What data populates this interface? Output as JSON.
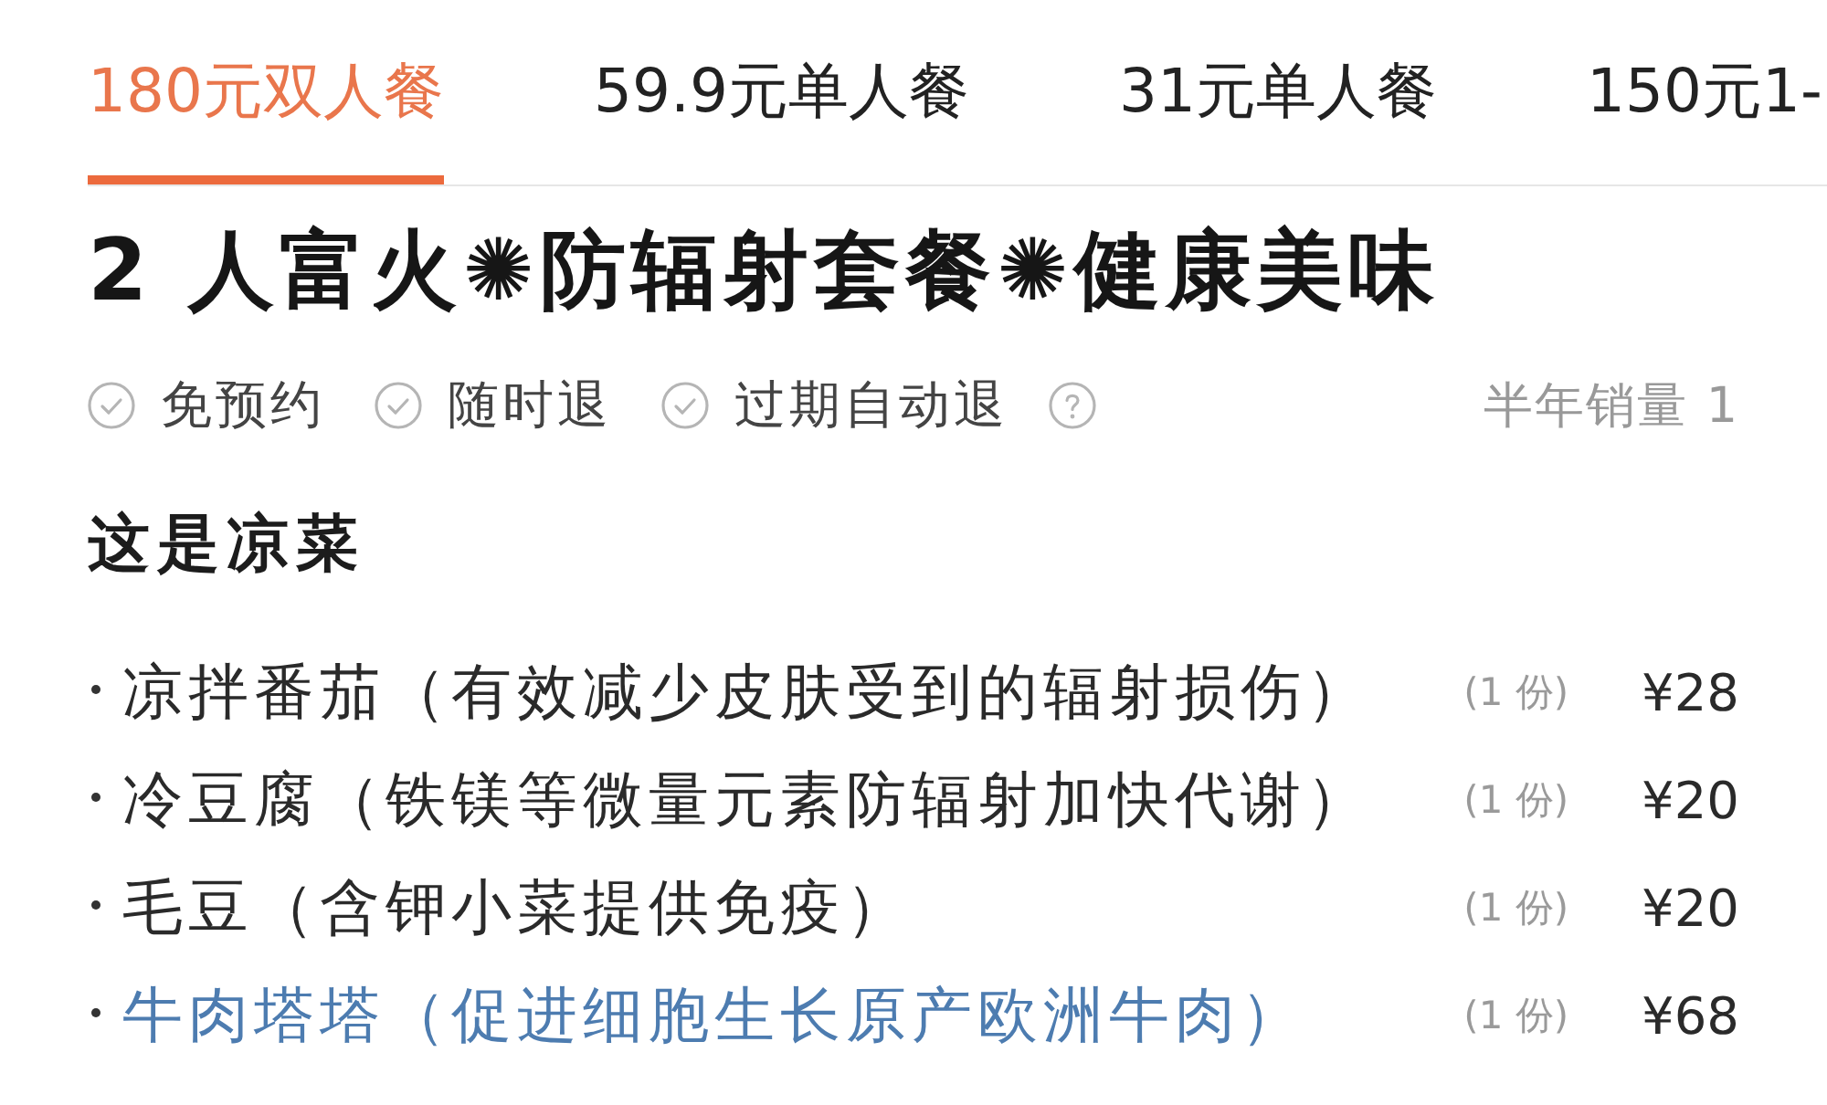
{
  "tabs": [
    {
      "label": "180元双人餐",
      "selected": true
    },
    {
      "label": "59.9元单人餐",
      "selected": false
    },
    {
      "label": "31元单人餐",
      "selected": false
    },
    {
      "label": "150元1-",
      "selected": false
    }
  ],
  "package": {
    "title": "2 人富火✺防辐射套餐✺健康美味",
    "tags": [
      {
        "label": "免预约",
        "help": false
      },
      {
        "label": "随时退",
        "help": false
      },
      {
        "label": "过期自动退",
        "help": true
      }
    ],
    "sales": "半年销量 1"
  },
  "section": {
    "heading": "这是凉菜",
    "items": [
      {
        "name": "凉拌番茄（有效减少皮肤受到的辐射损伤）",
        "quantity": "(1 份)",
        "price": "¥28",
        "highlighted": false
      },
      {
        "name": "冷豆腐（铁镁等微量元素防辐射加快代谢）",
        "quantity": "(1 份)",
        "price": "¥20",
        "highlighted": false
      },
      {
        "name": "毛豆（含钾小菜提供免疫）",
        "quantity": "(1 份)",
        "price": "¥20",
        "highlighted": false
      },
      {
        "name": "牛肉塔塔（促进细胞生长原产欧洲牛肉）",
        "quantity": "(1 份)",
        "price": "¥68",
        "highlighted": true
      }
    ]
  }
}
